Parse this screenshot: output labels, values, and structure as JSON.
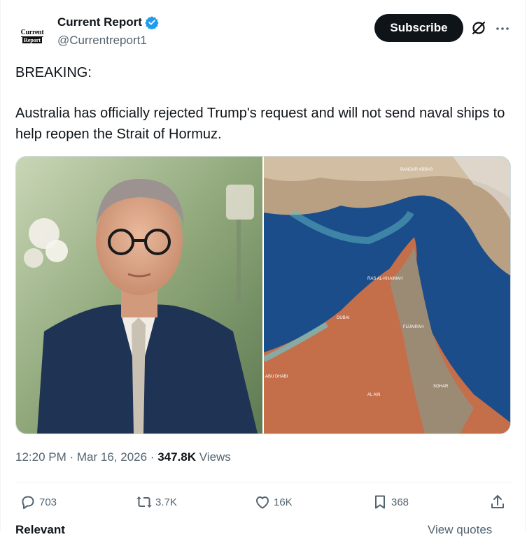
{
  "account": {
    "display_name": "Current Report",
    "handle": "@Currentreport1",
    "avatar_logo_top": "Current",
    "avatar_logo_bottom": "Report"
  },
  "header": {
    "subscribe_label": "Subscribe",
    "grok_icon": "grok-icon",
    "more_icon": "more-icon"
  },
  "post": {
    "line1": "BREAKING:",
    "line2": "Australia has officially rejected Trump's request and will not send naval ships to help reopen the Strait of Hormuz."
  },
  "map_labels": {
    "bandar_abbas": "BANDAR ABBAS",
    "ras_al_khaimah": "RAS AL-KHAIMAH",
    "dubai": "DUBAI",
    "fujairah": "FUJAIRAH",
    "abu_dhabi": "ABU DHABI",
    "al_ain": "AL AIN",
    "sohar": "SOHAR"
  },
  "meta": {
    "time": "12:20 PM",
    "date": "Mar 16, 2026",
    "views_count": "347.8K",
    "views_label": "Views"
  },
  "actions": {
    "replies": "703",
    "reposts": "3.7K",
    "likes": "16K",
    "bookmarks": "368"
  },
  "footer": {
    "left": "Relevant",
    "right": "View quotes"
  },
  "colors": {
    "verified": "#1d9bf0",
    "text_primary": "#0f1419",
    "text_secondary": "#536471"
  }
}
